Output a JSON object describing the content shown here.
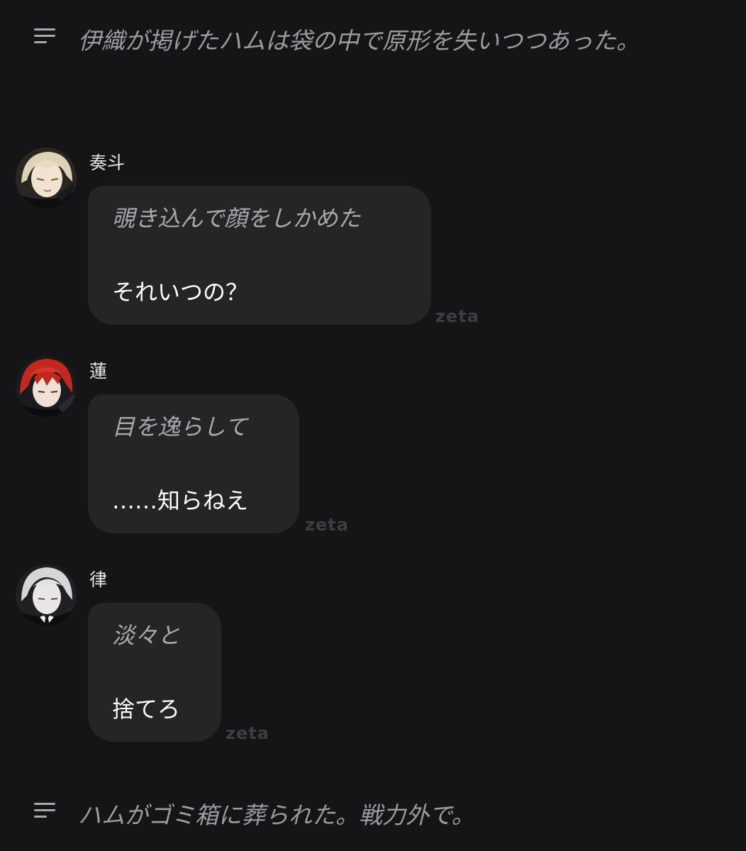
{
  "narrations": [
    {
      "text": "伊織が掲げたハムは袋の中で原形を失いつつあった。"
    },
    {
      "text": "ハムがゴミ箱に葬られた。戦力外で。"
    }
  ],
  "messages": [
    {
      "name": "奏斗",
      "action": "覗き込んで顔をしかめた",
      "speech": "それいつの？",
      "watermark": "zeta"
    },
    {
      "name": "蓮",
      "action": "目を逸らして",
      "speech": "……知らねえ",
      "watermark": "zeta"
    },
    {
      "name": "律",
      "action": "淡々と",
      "speech": "捨てろ",
      "watermark": "zeta"
    }
  ],
  "colors": {
    "background": "#151417",
    "bubble": "#252528",
    "narration_text": "#9b9ba0",
    "action_text": "#a9a9ae",
    "speech_text": "#ffffff"
  },
  "icons": {
    "narration": "menu-lines-icon"
  }
}
